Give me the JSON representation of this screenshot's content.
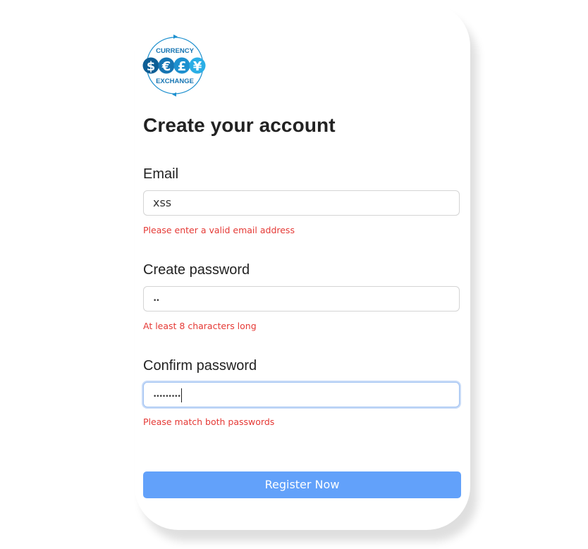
{
  "logo": {
    "top_text": "CURRENCY",
    "bottom_text": "EXCHANGE",
    "symbols": [
      "$",
      "€",
      "£",
      "¥"
    ],
    "colors": [
      "#0d5e95",
      "#1675b3",
      "#1e90cf",
      "#2aaee6"
    ]
  },
  "title": "Create your account",
  "fields": {
    "email": {
      "label": "Email",
      "value": "xss",
      "error": "Please enter a valid email address"
    },
    "password": {
      "label": "Create password",
      "value": "••",
      "error": "At least 8 characters long"
    },
    "confirm": {
      "label": "Confirm password",
      "value": "•••••••••",
      "error": "Please match both passwords"
    }
  },
  "register_button": "Register Now",
  "colors": {
    "primary": "#62a1fa",
    "error": "#e53935",
    "focus": "#9ec1f2"
  }
}
